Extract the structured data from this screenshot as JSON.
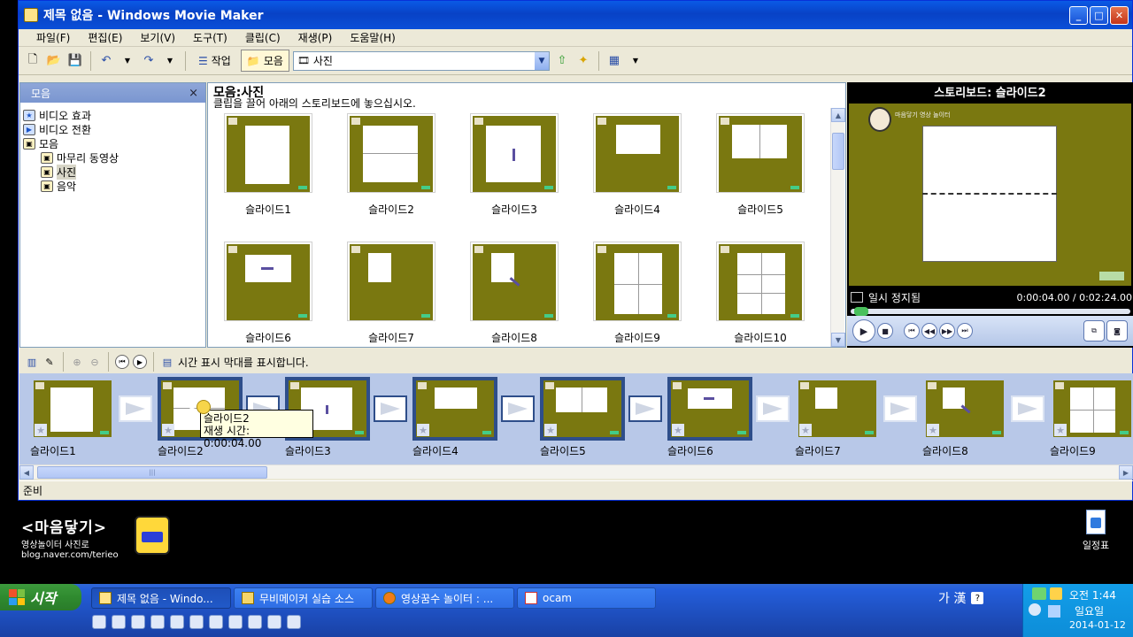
{
  "window": {
    "title": "제목 없음 - Windows Movie Maker",
    "min": "_",
    "max": "□",
    "close": "✕"
  },
  "menu": [
    "파일(F)",
    "편집(E)",
    "보기(V)",
    "도구(T)",
    "클립(C)",
    "재생(P)",
    "도움말(H)"
  ],
  "toolbar": {
    "tasks_label": "작업",
    "collections_label": "모음",
    "collection_combo_value": "사진"
  },
  "left_pane": {
    "header": "모음",
    "close": "×",
    "items": [
      {
        "label": "비디오 효과",
        "icon": "star-icon",
        "indent": 0
      },
      {
        "label": "비디오 전환",
        "icon": "transition-icon",
        "indent": 0
      },
      {
        "label": "모음",
        "icon": "collection-icon",
        "indent": 0
      },
      {
        "label": "마무리 동영상",
        "icon": "collection-icon",
        "indent": 1
      },
      {
        "label": "사진",
        "icon": "collection-icon",
        "indent": 1,
        "selected": true
      },
      {
        "label": "음악",
        "icon": "collection-icon",
        "indent": 1
      }
    ]
  },
  "center_pane": {
    "title": "모음:사진",
    "subtitle": "클립을 끌어 아래의 스토리보드에 놓으십시오.",
    "clips": [
      {
        "label": "슬라이드1",
        "layout": "box-tall"
      },
      {
        "label": "슬라이드2",
        "layout": "box-split-h"
      },
      {
        "label": "슬라이드3",
        "layout": "box-arrow-up"
      },
      {
        "label": "슬라이드4",
        "layout": "box-wide-top"
      },
      {
        "label": "슬라이드5",
        "layout": "box-split-v"
      },
      {
        "label": "슬라이드6",
        "layout": "box-arrow-left"
      },
      {
        "label": "슬라이드7",
        "layout": "box-small"
      },
      {
        "label": "슬라이드8",
        "layout": "box-small-diag"
      },
      {
        "label": "슬라이드9",
        "layout": "box-quad"
      },
      {
        "label": "슬라이드10",
        "layout": "box-quad-lines"
      }
    ]
  },
  "preview": {
    "title": "스토리보드: 슬라이드2",
    "status": "일시 정지됨",
    "time": "0:00:04.00 / 0:02:24.00",
    "face_text": "마음닿기 영상 놀이터"
  },
  "storyboard_toolbar": {
    "timeline_label": "시간 표시 막대를 표시합니다."
  },
  "storyboard": [
    {
      "label": "슬라이드1",
      "layout": "box-tall",
      "selected": false
    },
    {
      "label": "슬라이드2",
      "layout": "box-split-h",
      "selected": true
    },
    {
      "label": "슬라이드3",
      "layout": "box-arrow-up",
      "selected": true
    },
    {
      "label": "슬라이드4",
      "layout": "box-wide-top",
      "selected": true
    },
    {
      "label": "슬라이드5",
      "layout": "box-split-v",
      "selected": true
    },
    {
      "label": "슬라이드6",
      "layout": "box-arrow-left",
      "selected": true
    },
    {
      "label": "슬라이드7",
      "layout": "box-small",
      "selected": false
    },
    {
      "label": "슬라이드8",
      "layout": "box-small-diag",
      "selected": false
    },
    {
      "label": "슬라이드9",
      "layout": "box-quad",
      "selected": false
    }
  ],
  "tooltip": {
    "line1": "슬라이드2",
    "line2": "재생 시간:  0:00:04.00"
  },
  "statusbar": {
    "text": "준비"
  },
  "desktop": {
    "logo_text": "<마음닿기>",
    "logo_sub": "영상놀이터 사진로",
    "logo_url": "blog.naver.com/terieo",
    "icon_label": "일정표"
  },
  "taskbar": {
    "start": "시작",
    "tasks": [
      {
        "label": "제목 없음 - Windo...",
        "active": true
      },
      {
        "label": "무비메이커 실습 소스",
        "active": false
      },
      {
        "label": "영상꿈수 놀이터 : ...",
        "active": false
      },
      {
        "label": "ocam",
        "active": false
      }
    ],
    "ime": "가 漢",
    "help": "?",
    "tray_time": "오전 1:44",
    "tray_day": "일요일",
    "tray_date": "2014-01-12"
  },
  "colors": {
    "slide_bg": "#7a7810",
    "selection": "#2e4e8a",
    "title_blue": "#0a5ae6",
    "taskbar_blue": "#245edb"
  }
}
